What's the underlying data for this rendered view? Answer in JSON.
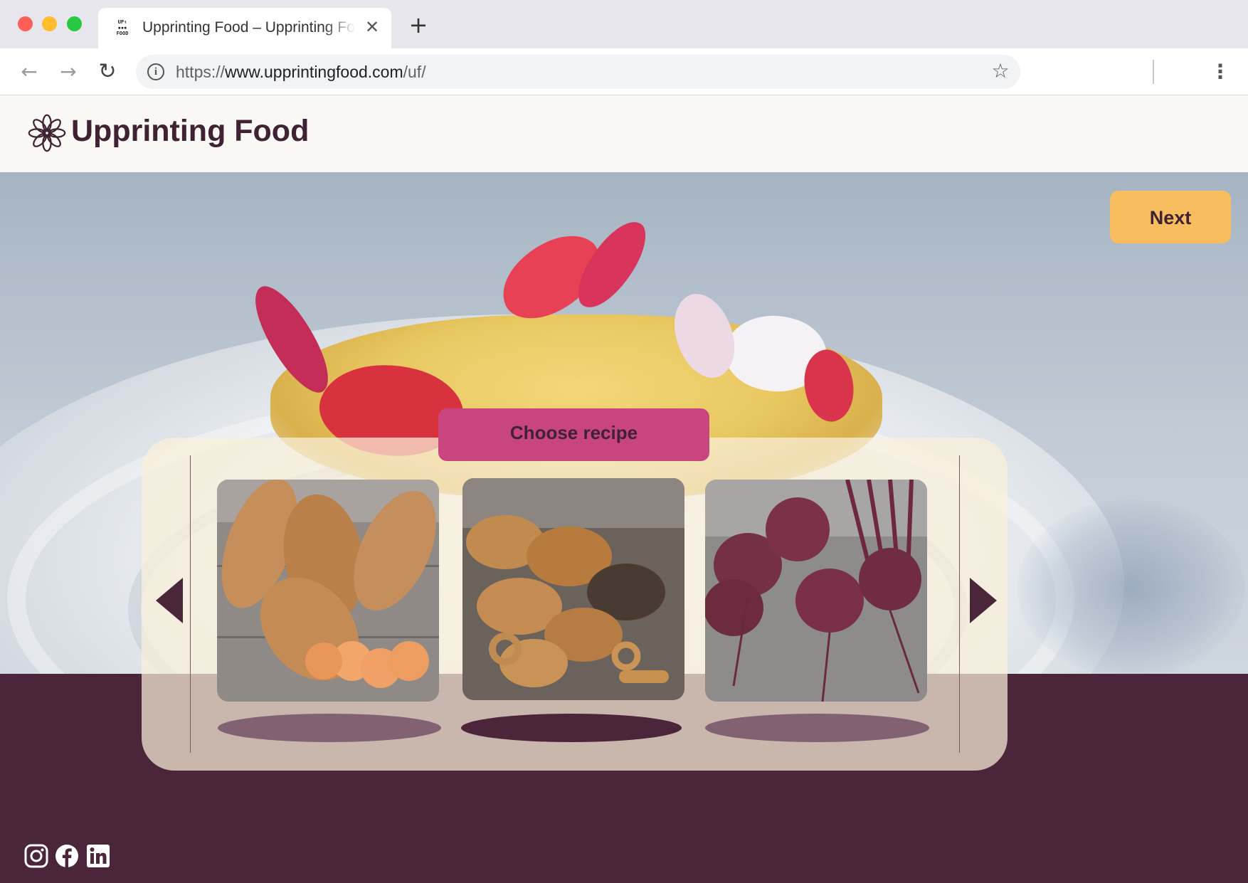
{
  "browser": {
    "tab_title": "Upprinting Food – Upprinting Food",
    "favicon_text": "UP↑ PRINTING FOOD",
    "url_scheme": "https://",
    "url_host": "www.upprintingfood.com",
    "url_path": "/uf/"
  },
  "header": {
    "brand": "Upprinting Food"
  },
  "hero": {
    "next_label": "Next"
  },
  "chooser": {
    "title": "Choose recipe",
    "recipes": [
      {
        "image": "sweet-potatoes",
        "selected": false
      },
      {
        "image": "bread-rolls",
        "selected": true
      },
      {
        "image": "beetroots",
        "selected": false
      }
    ]
  },
  "social": [
    "instagram",
    "facebook",
    "linkedin"
  ],
  "colors": {
    "brand_dark": "#4b263b",
    "accent_pink": "#c9457f",
    "accent_yellow": "#f8bd5f",
    "header_bg": "#faf8f4"
  }
}
